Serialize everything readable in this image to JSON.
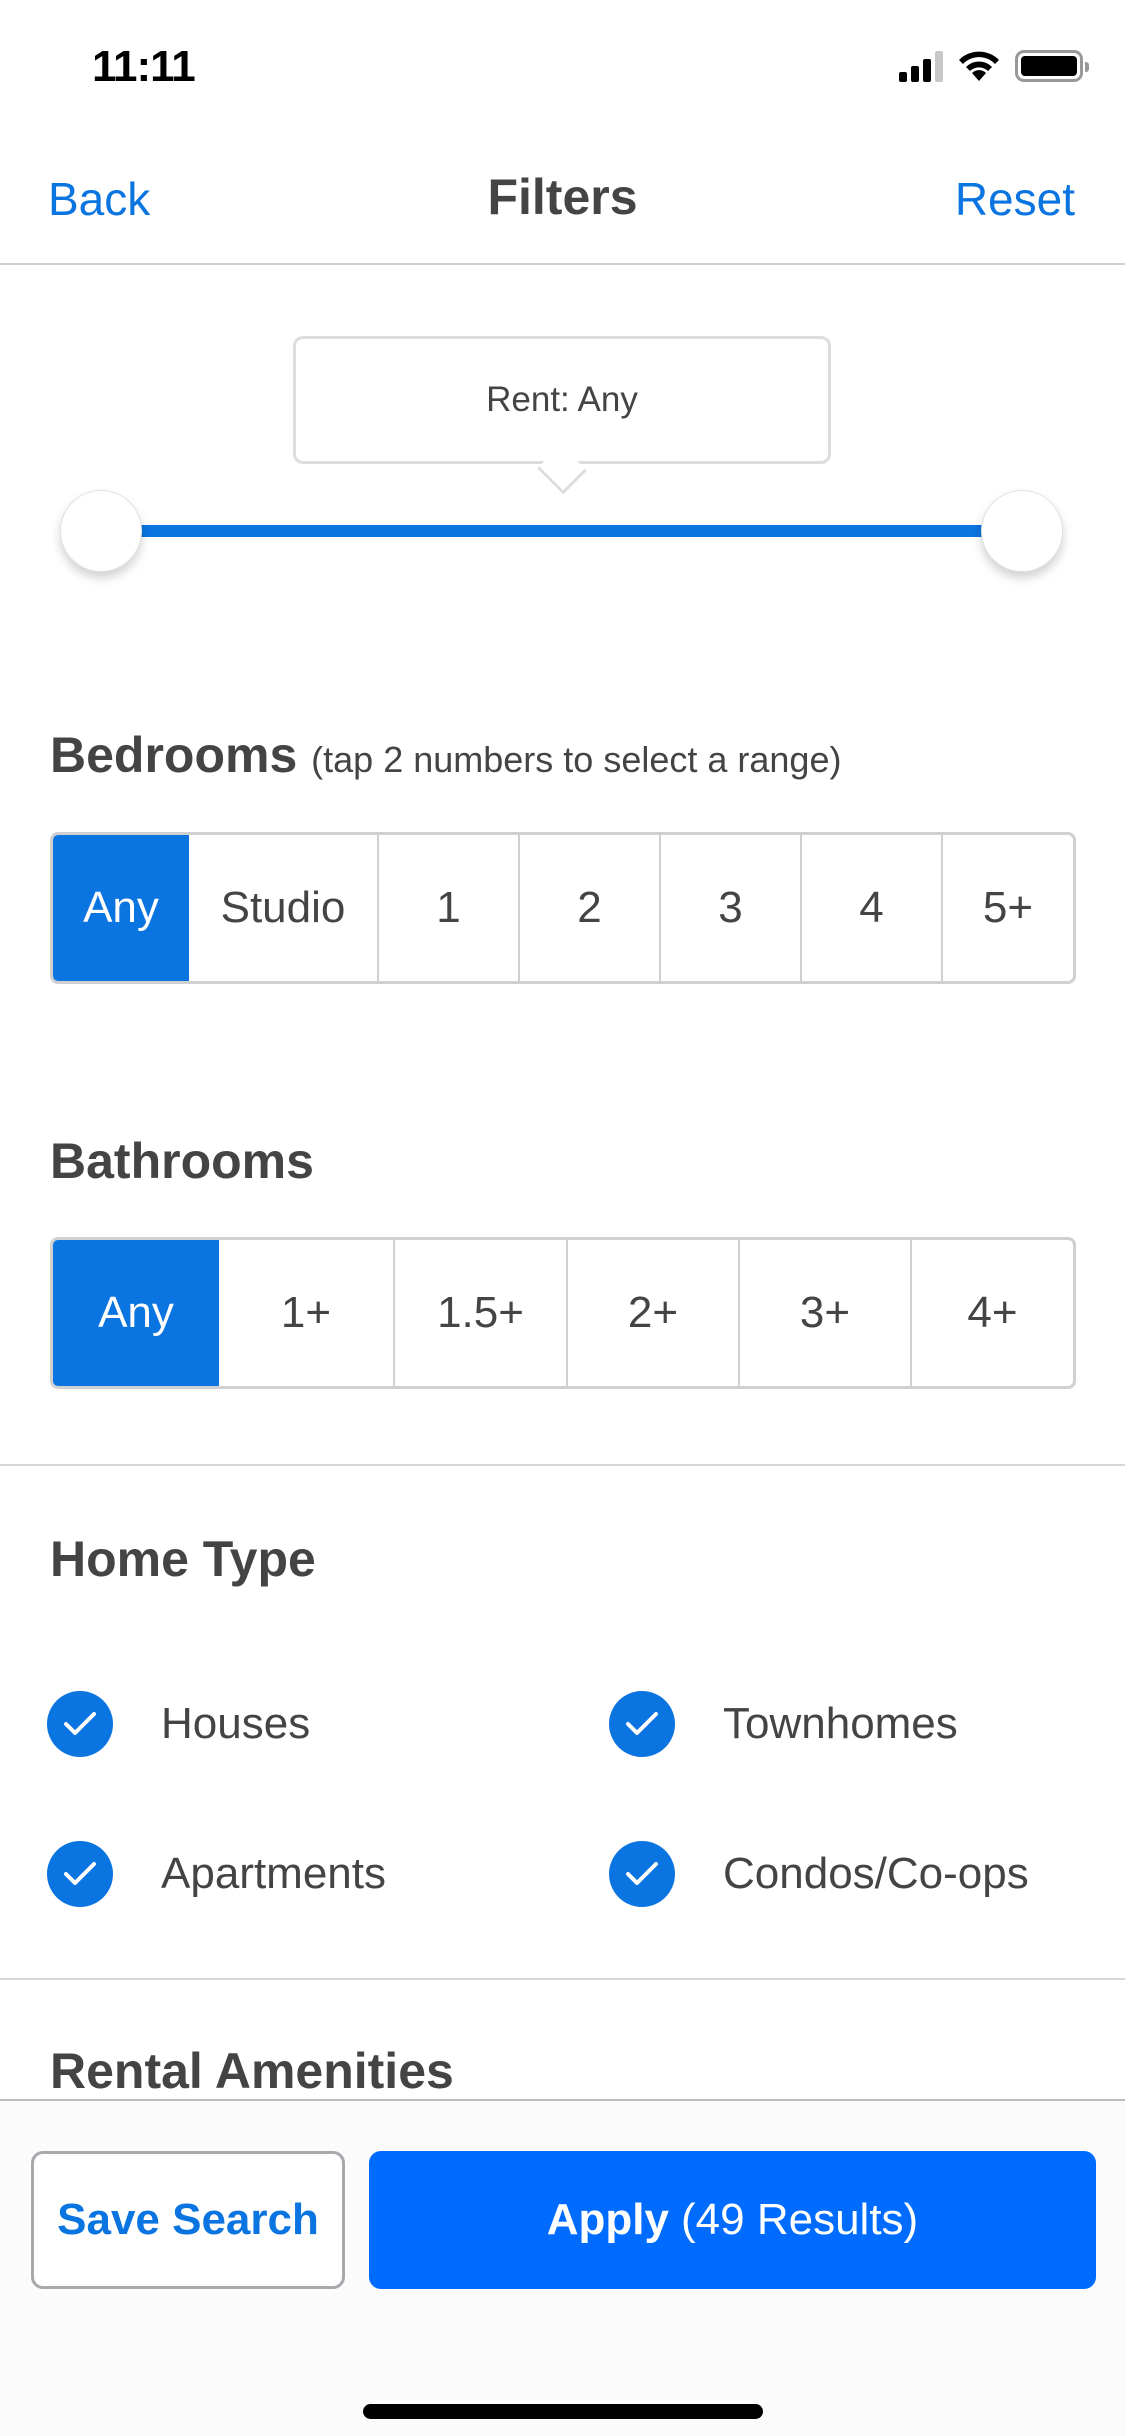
{
  "status_bar": {
    "time": "11:11",
    "icons": [
      "cellular-signal-icon",
      "wifi-icon",
      "battery-icon"
    ]
  },
  "nav": {
    "back_label": "Back",
    "title": "Filters",
    "reset_label": "Reset"
  },
  "rent": {
    "tooltip": "Rent: Any",
    "range_selected_fraction": [
      0,
      1
    ]
  },
  "bedrooms": {
    "title": "Bedrooms",
    "hint": "(tap 2 numbers to select a range)",
    "options": [
      "Any",
      "Studio",
      "1",
      "2",
      "3",
      "4",
      "5+"
    ],
    "selected": "Any"
  },
  "bathrooms": {
    "title": "Bathrooms",
    "options": [
      "Any",
      "1+",
      "1.5+",
      "2+",
      "3+",
      "4+"
    ],
    "selected": "Any"
  },
  "home_type": {
    "title": "Home Type",
    "items": [
      {
        "label": "Houses",
        "checked": true
      },
      {
        "label": "Townhomes",
        "checked": true
      },
      {
        "label": "Apartments",
        "checked": true
      },
      {
        "label": "Condos/Co-ops",
        "checked": true
      }
    ]
  },
  "rental_amenities": {
    "title": "Rental Amenities"
  },
  "footer": {
    "save_label": "Save Search",
    "apply_label": "Apply",
    "apply_count": "(49 Results)"
  },
  "colors": {
    "accent": "#0a74e0",
    "apply_button": "#006cff",
    "text": "#444444"
  }
}
